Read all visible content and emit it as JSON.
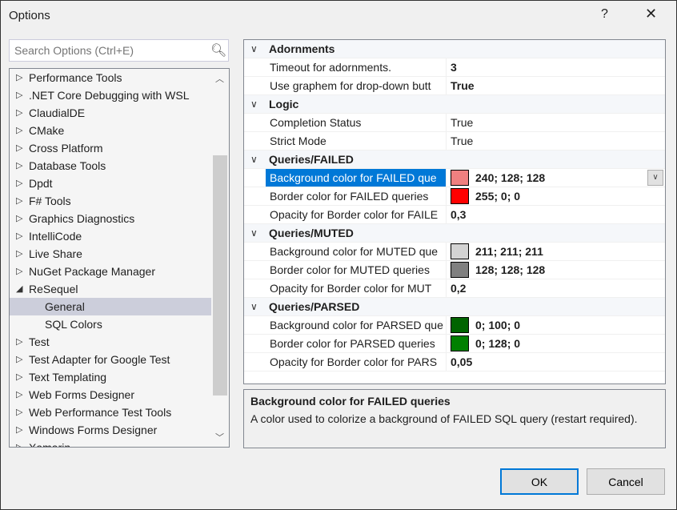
{
  "window": {
    "title": "Options",
    "help": "?",
    "close": "✕"
  },
  "search": {
    "placeholder": "Search Options (Ctrl+E)"
  },
  "tree": [
    {
      "label": "Performance Tools",
      "arrow": "▷"
    },
    {
      "label": ".NET Core Debugging with WSL",
      "arrow": "▷"
    },
    {
      "label": "ClaudialDE",
      "arrow": "▷"
    },
    {
      "label": "CMake",
      "arrow": "▷"
    },
    {
      "label": "Cross Platform",
      "arrow": "▷"
    },
    {
      "label": "Database Tools",
      "arrow": "▷"
    },
    {
      "label": "Dpdt",
      "arrow": "▷"
    },
    {
      "label": "F# Tools",
      "arrow": "▷"
    },
    {
      "label": "Graphics Diagnostics",
      "arrow": "▷"
    },
    {
      "label": "IntelliCode",
      "arrow": "▷"
    },
    {
      "label": "Live Share",
      "arrow": "▷"
    },
    {
      "label": "NuGet Package Manager",
      "arrow": "▷"
    },
    {
      "label": "ReSequel",
      "arrow": "◢"
    },
    {
      "label": "General",
      "child": true,
      "selected": true
    },
    {
      "label": "SQL Colors",
      "child": true
    },
    {
      "label": "Test",
      "arrow": "▷"
    },
    {
      "label": "Test Adapter for Google Test",
      "arrow": "▷"
    },
    {
      "label": "Text Templating",
      "arrow": "▷"
    },
    {
      "label": "Web Forms Designer",
      "arrow": "▷"
    },
    {
      "label": "Web Performance Test Tools",
      "arrow": "▷"
    },
    {
      "label": "Windows Forms Designer",
      "arrow": "▷"
    },
    {
      "label": "Xamarin",
      "arrow": "▷"
    }
  ],
  "grid": [
    {
      "category": "Adornments",
      "props": [
        {
          "name": "Timeout for adornments.",
          "value": "3",
          "bold": true
        },
        {
          "name": "Use graphem for drop-down butt",
          "value": "True",
          "bold": true
        }
      ]
    },
    {
      "category": "Logic",
      "props": [
        {
          "name": "Completion Status",
          "value": "True"
        },
        {
          "name": "Strict Mode",
          "value": "True"
        }
      ]
    },
    {
      "category": "Queries/FAILED",
      "props": [
        {
          "name": "Background color for FAILED que",
          "value": "240; 128; 128",
          "color": "#f08080",
          "bold": true,
          "selected": true
        },
        {
          "name": "Border color for FAILED queries",
          "value": "255; 0; 0",
          "color": "#ff0000",
          "bold": true
        },
        {
          "name": "Opacity for Border color for FAILE",
          "value": "0,3",
          "bold": true
        }
      ]
    },
    {
      "category": "Queries/MUTED",
      "props": [
        {
          "name": "Background color for MUTED que",
          "value": "211; 211; 211",
          "color": "#d3d3d3",
          "bold": true
        },
        {
          "name": "Border color for MUTED queries",
          "value": "128; 128; 128",
          "color": "#808080",
          "bold": true
        },
        {
          "name": "Opacity for Border color for MUT",
          "value": "0,2",
          "bold": true
        }
      ]
    },
    {
      "category": "Queries/PARSED",
      "props": [
        {
          "name": "Background color for PARSED que",
          "value": "0; 100; 0",
          "color": "#006400",
          "bold": true
        },
        {
          "name": "Border color for PARSED queries",
          "value": "0; 128; 0",
          "color": "#008000",
          "bold": true
        },
        {
          "name": "Opacity for Border color for PARS",
          "value": "0,05",
          "bold": true
        }
      ]
    }
  ],
  "description": {
    "title": "Background color for FAILED queries",
    "text": "A color used to colorize a background of FAILED SQL query (restart required)."
  },
  "buttons": {
    "ok": "OK",
    "cancel": "Cancel"
  }
}
